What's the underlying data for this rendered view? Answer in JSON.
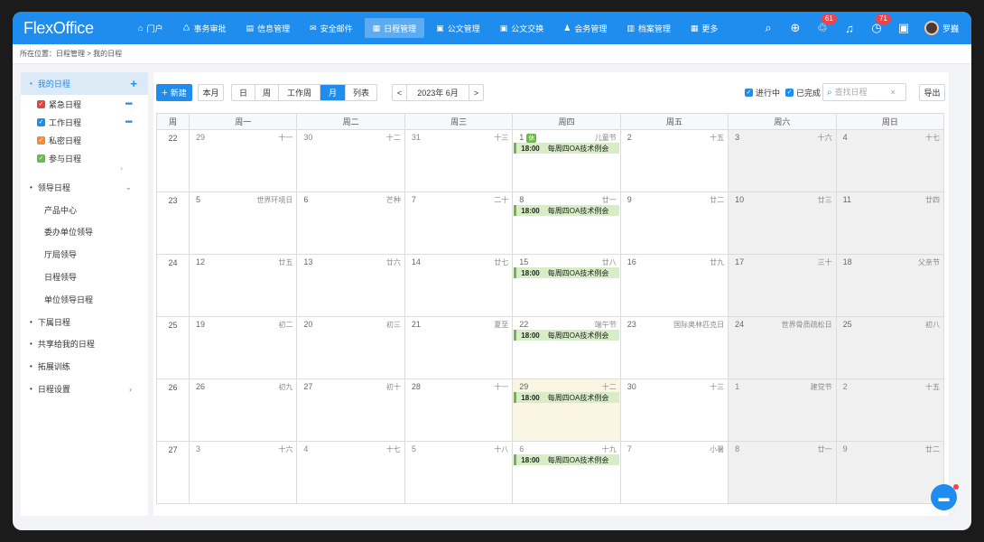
{
  "app": {
    "logo": "FlexOffice",
    "user": "罗巍"
  },
  "nav": [
    {
      "label": "门户",
      "icon": "home-icon",
      "glyph": "⌂"
    },
    {
      "label": "事务审批",
      "icon": "approval-icon",
      "glyph": "♺"
    },
    {
      "label": "信息管理",
      "icon": "document-icon",
      "glyph": "▤"
    },
    {
      "label": "安全邮件",
      "icon": "mail-icon",
      "glyph": "✉"
    },
    {
      "label": "日程管理",
      "icon": "calendar-icon",
      "glyph": "▦"
    },
    {
      "label": "公文管理",
      "icon": "briefcase-icon",
      "glyph": "▣"
    },
    {
      "label": "公文交换",
      "icon": "lock-icon",
      "glyph": "▣"
    },
    {
      "label": "会务管理",
      "icon": "person-icon",
      "glyph": "♟"
    },
    {
      "label": "档案管理",
      "icon": "archive-icon",
      "glyph": "▥"
    },
    {
      "label": "更多",
      "icon": "grid-icon",
      "glyph": "▦"
    }
  ],
  "nav_active": 4,
  "tools": {
    "badge_a": "61",
    "badge_b": "71"
  },
  "breadcrumb": {
    "prefix": "所在位置：",
    "path": "日程管理 > 我的日程"
  },
  "sidebar": {
    "my_schedule": "我的日程",
    "categories": [
      {
        "label": "紧急日程",
        "color": "#e0483e",
        "more": "•••"
      },
      {
        "label": "工作日程",
        "color": "#1f8ded",
        "more": "•••"
      },
      {
        "label": "私密日程",
        "color": "#f08a3c",
        "more": ""
      },
      {
        "label": "参与日程",
        "color": "#6cb84a",
        "more": ""
      }
    ],
    "leader_schedule": "领导日程",
    "leaders": [
      "产品中心",
      "委办单位领导",
      "厅局领导",
      "日程领导",
      "单位领导日程"
    ],
    "others": [
      "下属日程",
      "共享给我的日程",
      "拓展训练",
      "日程设置"
    ]
  },
  "toolbar": {
    "new_label": "新建",
    "this_month": "本月",
    "views": [
      "日",
      "周",
      "工作周",
      "月",
      "列表"
    ],
    "active_view": 3,
    "month_label": "2023年 6月",
    "prev": "<",
    "next": ">",
    "in_progress": "进行中",
    "completed": "已完成",
    "search_placeholder": "查找日程",
    "export": "导出"
  },
  "calendar": {
    "week_header": "周",
    "weekdays": [
      "周一",
      "周二",
      "周三",
      "周四",
      "周五",
      "周六",
      "周日"
    ],
    "weeks": [
      {
        "wk": "22",
        "days": [
          {
            "d": "29",
            "l": "十一"
          },
          {
            "d": "30",
            "l": "十二"
          },
          {
            "d": "31",
            "l": "十三"
          },
          {
            "d": "1",
            "l": "儿童节",
            "tag": "休",
            "ev": true,
            "cur": true
          },
          {
            "d": "2",
            "l": "十五",
            "cur": true
          },
          {
            "d": "3",
            "l": "十六",
            "cur": true
          },
          {
            "d": "4",
            "l": "十七",
            "cur": true
          }
        ]
      },
      {
        "wk": "23",
        "days": [
          {
            "d": "5",
            "l": "世界环境日",
            "cur": true
          },
          {
            "d": "6",
            "l": "芒种",
            "cur": true
          },
          {
            "d": "7",
            "l": "二十",
            "cur": true
          },
          {
            "d": "8",
            "l": "廿一",
            "ev": true,
            "cur": true
          },
          {
            "d": "9",
            "l": "廿二",
            "cur": true
          },
          {
            "d": "10",
            "l": "廿三",
            "cur": true
          },
          {
            "d": "11",
            "l": "廿四",
            "cur": true
          }
        ]
      },
      {
        "wk": "24",
        "days": [
          {
            "d": "12",
            "l": "廿五",
            "cur": true
          },
          {
            "d": "13",
            "l": "廿六",
            "cur": true
          },
          {
            "d": "14",
            "l": "廿七",
            "cur": true
          },
          {
            "d": "15",
            "l": "廿八",
            "ev": true,
            "cur": true
          },
          {
            "d": "16",
            "l": "廿九",
            "cur": true
          },
          {
            "d": "17",
            "l": "三十",
            "cur": true
          },
          {
            "d": "18",
            "l": "父亲节",
            "cur": true
          }
        ]
      },
      {
        "wk": "25",
        "days": [
          {
            "d": "19",
            "l": "初二",
            "cur": true
          },
          {
            "d": "20",
            "l": "初三",
            "cur": true
          },
          {
            "d": "21",
            "l": "夏至",
            "cur": true
          },
          {
            "d": "22",
            "l": "端午节",
            "ev": true,
            "cur": true
          },
          {
            "d": "23",
            "l": "国际奥林匹克日",
            "cur": true
          },
          {
            "d": "24",
            "l": "世界骨质疏松日",
            "cur": true
          },
          {
            "d": "25",
            "l": "初八",
            "cur": true
          }
        ]
      },
      {
        "wk": "26",
        "days": [
          {
            "d": "26",
            "l": "初九",
            "cur": true
          },
          {
            "d": "27",
            "l": "初十",
            "cur": true
          },
          {
            "d": "28",
            "l": "十一",
            "cur": true
          },
          {
            "d": "29",
            "l": "十二",
            "ev": true,
            "cur": true,
            "today": true
          },
          {
            "d": "30",
            "l": "十三",
            "cur": true
          },
          {
            "d": "1",
            "l": "建党节"
          },
          {
            "d": "2",
            "l": "十五"
          }
        ]
      },
      {
        "wk": "27",
        "days": [
          {
            "d": "3",
            "l": "十六"
          },
          {
            "d": "4",
            "l": "十七"
          },
          {
            "d": "5",
            "l": "十八"
          },
          {
            "d": "6",
            "l": "十九",
            "ev": true
          },
          {
            "d": "7",
            "l": "小暑"
          },
          {
            "d": "8",
            "l": "廿一"
          },
          {
            "d": "9",
            "l": "廿二"
          }
        ]
      }
    ],
    "event": {
      "time": "18:00",
      "title": "每周四OA技术例会"
    }
  }
}
